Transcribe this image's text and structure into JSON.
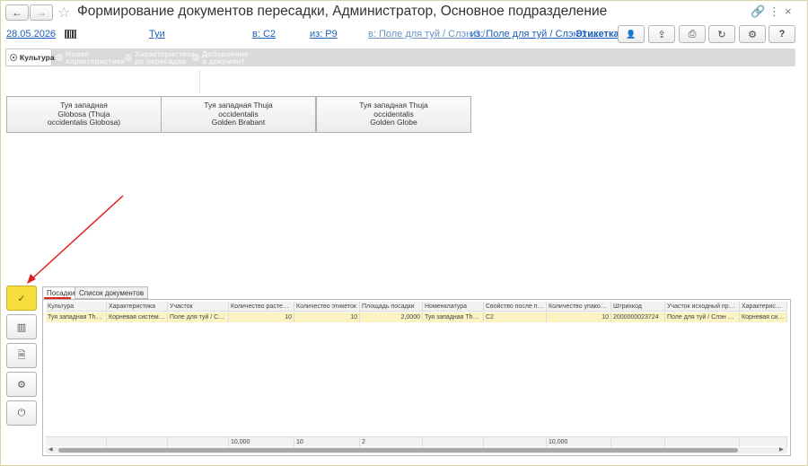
{
  "window": {
    "title": "Формирование документов пересадки, Администратор, Основное подразделение",
    "back_icon": "←",
    "forward_icon": "→",
    "star_icon": "☆",
    "link_icon": "🔗",
    "menu_icon": "⋮",
    "restore_icon": "□",
    "close_icon": "×"
  },
  "header": {
    "date": "28.05.2026",
    "culture_link": "Туи",
    "to_link": "в: С2",
    "from_link": "из: Р9",
    "field_to": "в: Поле для туй / Слэн 3 /...",
    "field_from": "из: Поле для туй / Слэн 1 ...",
    "label_link": "Этикетка"
  },
  "toolbar": {
    "user_icon": "👤",
    "export_icon": "⇪",
    "print_icon": "⎙",
    "refresh_icon": "↻",
    "settings_icon": "⚙",
    "help_label": "?"
  },
  "steps": [
    {
      "label": "Культура",
      "active": true
    },
    {
      "label": "Новая характеристика",
      "active": false
    },
    {
      "label": "Характеристика до пересадки",
      "active": false
    },
    {
      "label": "Добавление в документ",
      "active": false
    }
  ],
  "cultures": [
    "Туя западная\nGlobosa (Thuja\noccidentalis Globosa)",
    "Туя западная Thuja\noccidentalis\nGolden Brabant",
    "Туя западная Thuja\noccidentalis\nGolden Globe"
  ],
  "actions": {
    "confirm_icon": "✓",
    "barcode_icon": "▥",
    "document_icon": "🗎",
    "settings_icon": "⚙",
    "power_icon": "⏻"
  },
  "tabs": [
    "Посадки",
    "Список документов"
  ],
  "table": {
    "columns": [
      "Культура",
      "Характеристика",
      "Участок",
      "Количество растений",
      "Количество этикеток",
      "Площадь посадки",
      "Номенклатура",
      "Свойство после пе...",
      "Количество упаковок",
      "Штрихкод",
      "Участок исходный при п...",
      "Характеристика"
    ],
    "rows": [
      [
        "Туя западная Thuj...",
        "Корневая система...",
        "Поле для туй / Слэ...",
        "10",
        "10",
        "2,0000",
        "Туя западная Thuj...",
        "С2",
        "10",
        "2000000023724",
        "Поле для туй / Слэн 1 / ...",
        "Корневая систем..."
      ]
    ],
    "footer": [
      "",
      "",
      "",
      "10,000",
      "10",
      "2",
      "",
      "",
      "10,000",
      "",
      "",
      ""
    ]
  }
}
